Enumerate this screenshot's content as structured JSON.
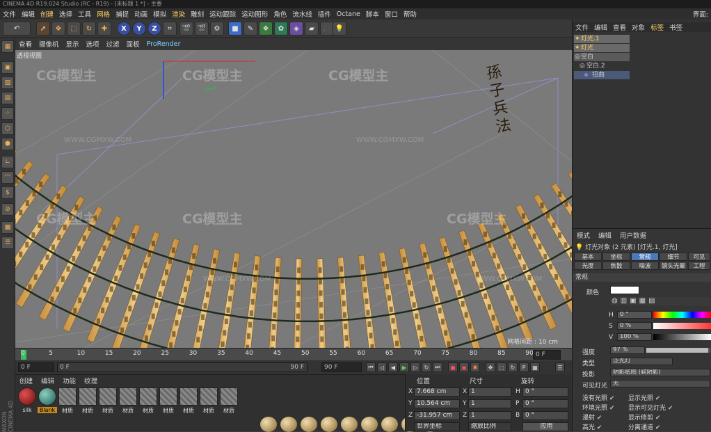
{
  "title": "CINEMA 4D R19.024 Studio (RC - R19) - [未标题 1 *] - 主要",
  "menu": [
    "文件",
    "编辑",
    "创建",
    "选择",
    "工具",
    "网格",
    "捕捉",
    "动画",
    "模拟",
    "渲染",
    "雕刻",
    "运动跟踪",
    "运动图形",
    "角色",
    "流水线",
    "插件",
    "Octane",
    "脚本",
    "窗口",
    "帮助"
  ],
  "menu_right": "界面:",
  "toolbar": {
    "undo": "↶",
    "x": "X",
    "y": "Y",
    "z": "Z"
  },
  "viewport_menu": [
    "查看",
    "摄像机",
    "显示",
    "选项",
    "过滤",
    "面板"
  ],
  "viewport_prorender": "ProRender",
  "viewport": {
    "label": "透视视图",
    "grid_info": "网格间距 : 10 cm",
    "scroll_title": "孫子兵法",
    "watermark": "CG模型主",
    "watermark_url": "WWW.CGMXW.COM"
  },
  "timeline": {
    "ticks": [
      "0",
      "5",
      "10",
      "15",
      "20",
      "25",
      "30",
      "35",
      "40",
      "45",
      "50",
      "55",
      "60",
      "65",
      "70",
      "75",
      "80",
      "85",
      "90"
    ],
    "end_field": "0 F"
  },
  "playbar": {
    "start": "0 F",
    "range_start": "0 F",
    "range_end": "90 F",
    "max": "90 F"
  },
  "materials": {
    "menu": [
      "创建",
      "编辑",
      "功能",
      "纹理"
    ],
    "items": [
      "silk",
      "Blank",
      "材质",
      "材质",
      "材质",
      "材质",
      "材质",
      "材质",
      "材质",
      "材质",
      "材质"
    ],
    "brand": "MAXON CINEMA 4D"
  },
  "coords": {
    "headers": [
      "位置",
      "尺寸",
      "旋转"
    ],
    "pos": {
      "x": "7.668 cm",
      "y": "10.564 cm",
      "z": "-31.957 cm"
    },
    "size": {
      "x": "1",
      "y": "1",
      "z": "1"
    },
    "rot": {
      "h": "0 °",
      "p": "0 °",
      "b": "0 °"
    },
    "axis_labels": {
      "x": "X",
      "y": "Y",
      "z": "Z",
      "h": "H",
      "p": "P",
      "b": "B"
    },
    "mode": "世界坐标",
    "scale_mode": "缩放比例",
    "apply": "应用"
  },
  "objects": {
    "menu": [
      "文件",
      "编辑",
      "查看",
      "对象",
      "标签",
      "书签"
    ],
    "menu_highlight": "标签",
    "items": [
      "灯光.1",
      "灯光",
      "空白",
      "空白.2",
      "扭曲"
    ]
  },
  "attributes": {
    "menu": [
      "模式",
      "编辑",
      "用户数据"
    ],
    "header": "灯光对象 (2 元素) [灯光.1, 灯光]",
    "tabs_row1": [
      "基本",
      "坐标",
      "常规",
      "细节",
      "可见"
    ],
    "tabs_row2": [
      "光度",
      "焦散",
      "噪波",
      "镜头光晕",
      "工程"
    ],
    "active_tab": "常规",
    "section": "常规",
    "color_label": "颜色",
    "h": "0 °",
    "s": "0 %",
    "v": "100 %",
    "hsv_labels": {
      "h": "H",
      "s": "S",
      "v": "V"
    },
    "intensity_label": "强度",
    "intensity": "97 %",
    "type_label": "类型",
    "type": "泛光灯",
    "shadow_label": "投影",
    "shadow": "阴影贴图 (软阴影)",
    "visible_light_label": "可见灯光",
    "visible_light": "无",
    "checks": [
      [
        "没有光照",
        "显示光照"
      ],
      [
        "环境光照",
        "显示可见灯光"
      ],
      [
        "漫射",
        "显示修剪"
      ],
      [
        "高光",
        "分离通道"
      ]
    ],
    "colors": {
      "accent": "#4a78b8",
      "highlight": "#ffd36a",
      "wood": "#e2b46a"
    }
  }
}
